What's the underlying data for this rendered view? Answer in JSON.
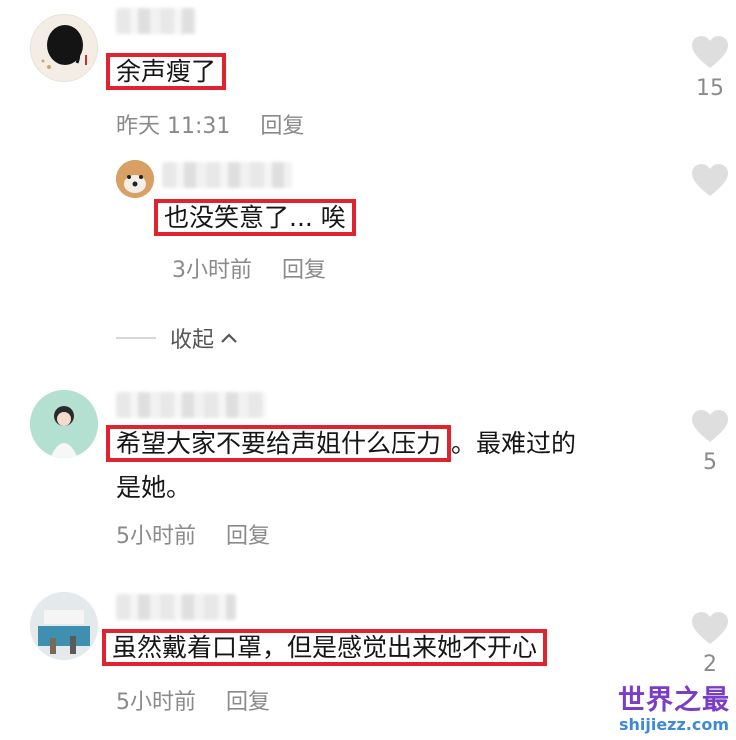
{
  "colors": {
    "highlight": "#e0242f",
    "meta_text": "#8a8a8a",
    "watermark_title": "#7a3dc8",
    "watermark_url": "#3d8bd8"
  },
  "comments": [
    {
      "text": "余声瘦了",
      "time": "昨天 11:31",
      "reply": "回复",
      "likes": "15"
    },
    {
      "text": "也没笑意了... 唉",
      "time": "3小时前",
      "reply": "回复",
      "likes": ""
    },
    {
      "text_highlighted": "希望大家不要给声姐什么压力",
      "text_rest": "。最难过的",
      "text_line2": "是她。",
      "time": "5小时前",
      "reply": "回复",
      "likes": "5"
    },
    {
      "text": "虽然戴着口罩，但是感觉出来她不开心",
      "time": "5小时前",
      "reply": "回复",
      "likes": "2"
    }
  ],
  "collapse_label": "收起",
  "watermark": {
    "title": "世界之最",
    "url": "shijiezz.com"
  },
  "icons": {
    "like": "heart-outline-icon",
    "collapse": "chevron-up-icon"
  }
}
